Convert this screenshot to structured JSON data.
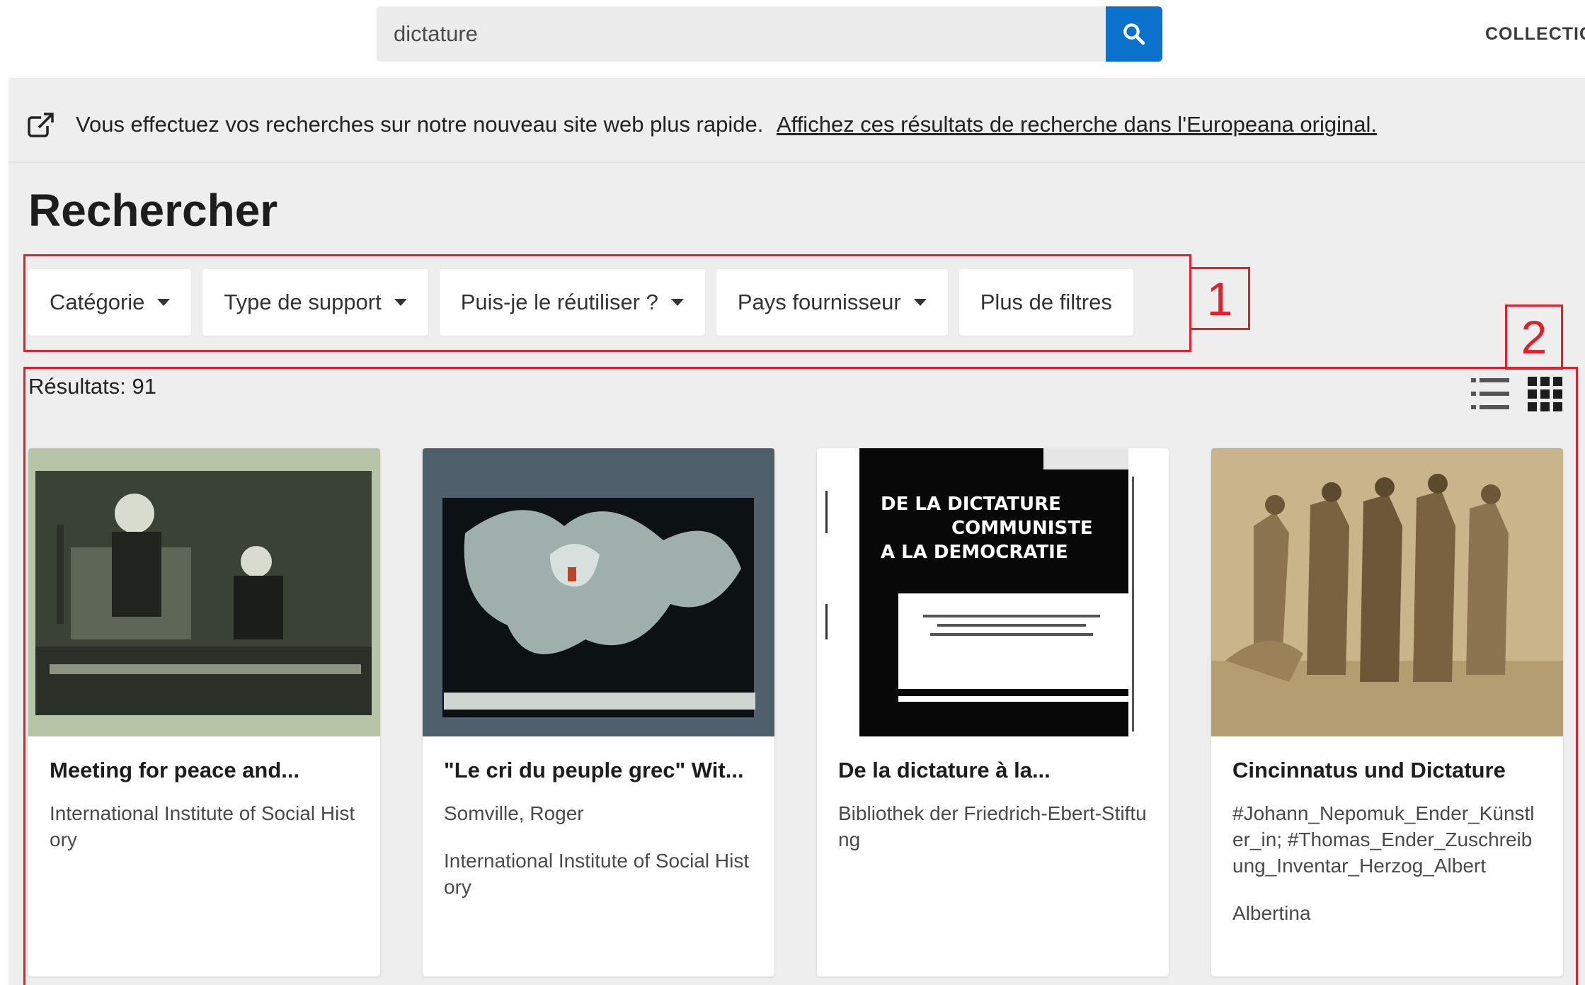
{
  "header": {
    "search_value": "dictature",
    "search_button_icon": "search-icon",
    "nav_collections": "COLLECTIO"
  },
  "notice": {
    "icon": "external-link-icon",
    "text": "Vous effectuez vos recherches sur notre nouveau site web plus rapide.",
    "link": "Affichez ces résultats de recherche dans l'Europeana original."
  },
  "page_title": "Rechercher",
  "filters": [
    {
      "label": "Catégorie",
      "has_caret": true
    },
    {
      "label": "Type de support",
      "has_caret": true
    },
    {
      "label": "Puis-je le réutiliser ?",
      "has_caret": true
    },
    {
      "label": "Pays fournisseur",
      "has_caret": true
    },
    {
      "label": "Plus de filtres",
      "has_caret": false
    }
  ],
  "annotations": {
    "label1": "1",
    "label2": "2",
    "color": "#e0202a"
  },
  "results": {
    "count_text": "Résultats: 91",
    "view_icons": [
      "list-view-icon",
      "grid-view-icon"
    ]
  },
  "cards": [
    {
      "title": "Meeting for peace and...",
      "lines": [
        "International Institute of Social History"
      ],
      "thumb": "photo-speaker-at-podium"
    },
    {
      "title": "\"Le cri du peuple grec\" Wit...",
      "lines": [
        "Somville, Roger",
        "International Institute of Social History"
      ],
      "thumb": "poster-screaming-figure"
    },
    {
      "title": "De la dictature à la...",
      "lines": [
        "Bibliothek der Friedrich-Ebert-Stiftung"
      ],
      "thumb": "document-cover",
      "thumb_text": [
        "DE LA DICTATURE",
        "COMMUNISTE",
        "A LA DEMOCRATIE"
      ]
    },
    {
      "title": "Cincinnatus und Dictature",
      "lines": [
        "#Johann_Nepomuk_Ender_Künstler_in; #Thomas_Ender_Zuschreibung_Inventar_Herzog_Albert",
        "Albertina"
      ],
      "thumb": "engraving-roman-figures"
    }
  ],
  "colors": {
    "accent": "#0a72cc",
    "background": "#eeeeee",
    "annotation": "#e0202a"
  }
}
